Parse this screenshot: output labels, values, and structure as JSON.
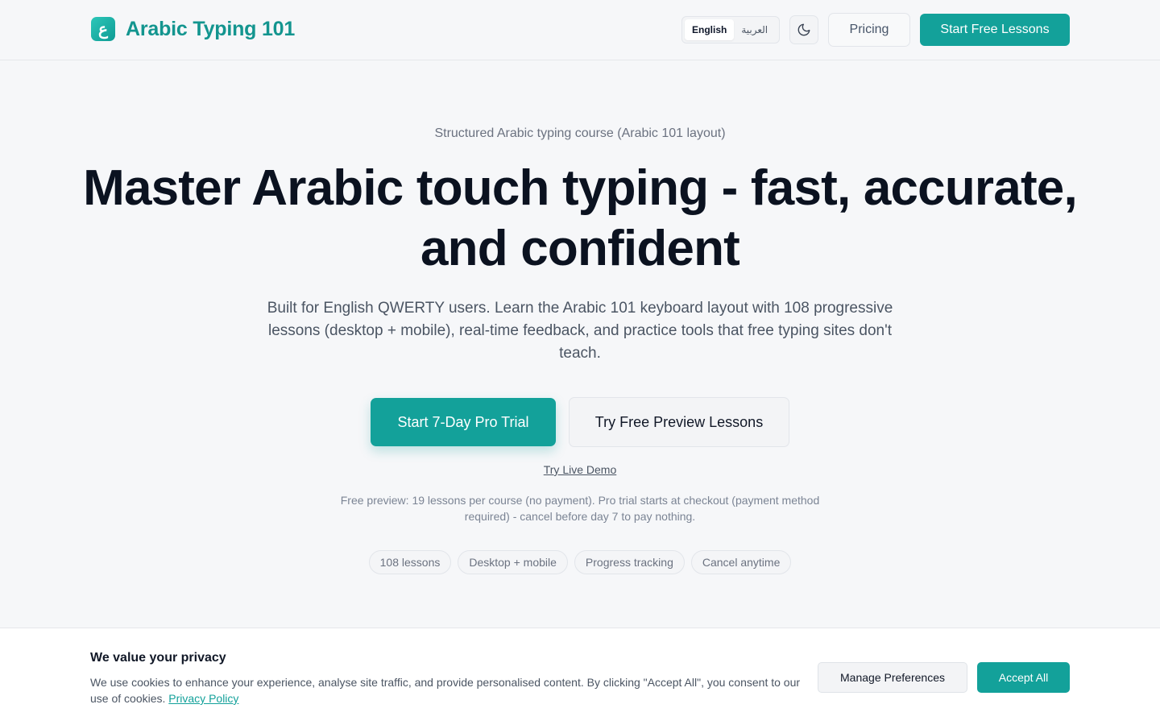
{
  "header": {
    "logo_glyph": "ع",
    "brand": "Arabic Typing 101",
    "lang_options": [
      "English",
      "العربية"
    ],
    "active_lang": "English",
    "theme_icon": "moon-icon",
    "pricing_label": "Pricing",
    "start_label": "Start Free Lessons"
  },
  "hero": {
    "eyebrow": "Structured Arabic typing course (Arabic 101 layout)",
    "title_line1": "Master Arabic touch typing - fast, accurate,",
    "title_line2": "and confident",
    "subtitle": "Built for English QWERTY users. Learn the Arabic 101 keyboard layout with 108 progressive lessons (desktop + mobile), real-time feedback, and practice tools that free typing sites don't teach.",
    "cta_primary": "Start 7-Day Pro Trial",
    "cta_secondary": "Try Free Preview Lessons",
    "demo_link": "Try Live Demo",
    "fine_print": "Free preview: 19 lessons per course (no payment). Pro trial starts at checkout (payment method required) - cancel before day 7 to pay nothing.",
    "chips": [
      "108 lessons",
      "Desktop + mobile",
      "Progress tracking",
      "Cancel anytime"
    ]
  },
  "cookie": {
    "title": "We value your privacy",
    "text": "We use cookies to enhance your experience, analyse site traffic, and provide personalised content. By clicking \"Accept All\", you consent to our use of cookies.",
    "policy_link": "Privacy Policy",
    "manage_label": "Manage Preferences",
    "accept_label": "Accept All"
  },
  "colors": {
    "accent": "#13a19a",
    "background": "#f6f7f9",
    "heading": "#0b1220"
  }
}
